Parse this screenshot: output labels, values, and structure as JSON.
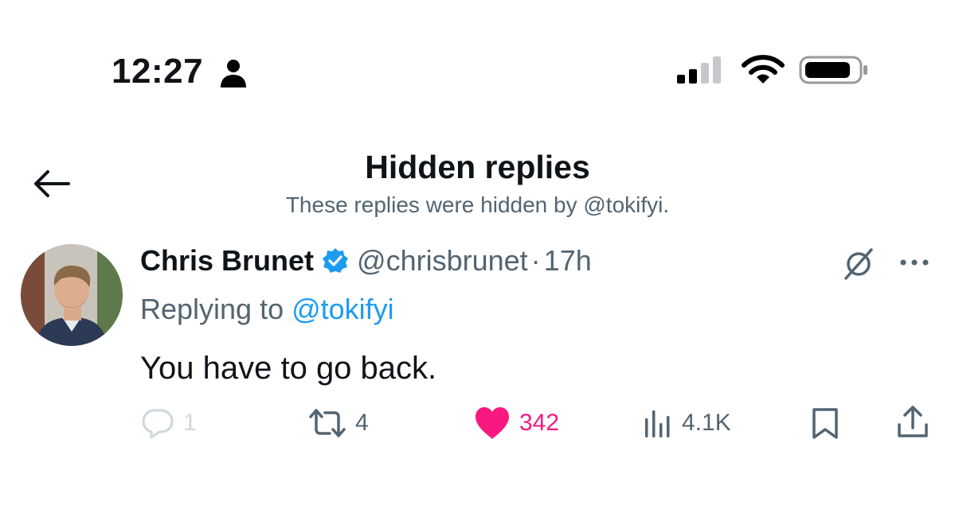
{
  "status_bar": {
    "time": "12:27",
    "icons": [
      "person-icon",
      "cellular-signal-icon",
      "wifi-icon",
      "battery-icon"
    ]
  },
  "header": {
    "title": "Hidden replies",
    "subtitle": "These replies were hidden by @tokifyi."
  },
  "tweet": {
    "author_name": "Chris Brunet",
    "handle": "@chrisbrunet",
    "separator": "·",
    "timestamp": "17h",
    "replying_label": "Replying to",
    "replying_handle": "@tokifyi",
    "text": "You have to go back.",
    "actions": {
      "replies": "1",
      "retweets": "4",
      "likes": "342",
      "views": "4.1K"
    }
  },
  "colors": {
    "text_primary": "#0f1419",
    "text_secondary": "#536471",
    "accent_blue": "#1d9bf0",
    "like_pink": "#f91880",
    "muted_gray": "#cfd9de",
    "verified_blue": "#1d9bf0"
  }
}
